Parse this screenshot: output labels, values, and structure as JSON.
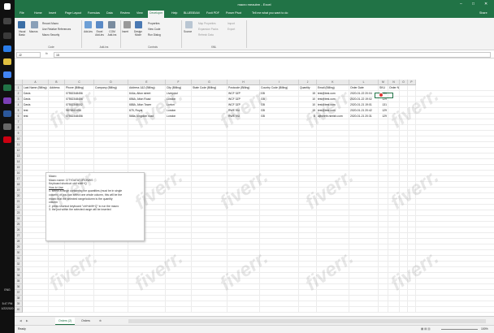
{
  "title": "macro meaubm - Excel",
  "window_controls": [
    "–",
    "□",
    "✕"
  ],
  "tabs": [
    "File",
    "Home",
    "Insert",
    "Page Layout",
    "Formulas",
    "Data",
    "Review",
    "View",
    "Developer",
    "Help",
    "BLUEBEAM",
    "Foxit PDF",
    "Power Pivot",
    "Tell me what you want to do",
    "Share"
  ],
  "active_tab": "Developer",
  "ribbon": {
    "code": {
      "visual_basic": "Visual Basic",
      "macros": "Macros",
      "record": "Record Macro",
      "relative": "Use Relative References",
      "security": "Macro Security",
      "group": "Code"
    },
    "addins": {
      "add_ins": "Add-ins",
      "excel_addins": "Excel Add-ins",
      "com_addins": "COM Add-ins",
      "group": "Add-ins"
    },
    "controls": {
      "insert": "Insert",
      "design": "Design Mode",
      "properties": "Properties",
      "view_code": "View Code",
      "run_dialog": "Run Dialog",
      "group": "Controls"
    },
    "xml": {
      "source": "Source",
      "map_props": "Map Properties",
      "expansion": "Expansion Packs",
      "refresh": "Refresh Data",
      "import": "Import",
      "export": "Export",
      "group": "XML"
    }
  },
  "name_box": "J2",
  "fx": "fx",
  "formula_value": "15",
  "columns": [
    "A",
    "B",
    "C",
    "D",
    "E",
    "F",
    "G",
    "H",
    "I",
    "J",
    "K",
    "L",
    "M",
    "N",
    "O",
    "P"
  ],
  "headers": [
    "Last Name (Billing)",
    "Address",
    "Phone (Billing)",
    "Company (Billing)",
    "Address 1&2 (Billing)",
    "City (Billing)",
    "State Code (Billing)",
    "Postcode (Billing)",
    "Country Code (Billing)",
    "Quantity",
    "Email (Billing)",
    "Order Date",
    "SKU",
    "Order Num"
  ],
  "rows": [
    [
      "Davis",
      "",
      "07552348456",
      "",
      "644a, Alton street",
      "Liverpool",
      "",
      "WCF 3ZP",
      "GB",
      "15",
      "test@test.com",
      "2020-01-22 20:04",
      "120",
      ""
    ],
    [
      "Davis",
      "",
      "07552348456",
      "",
      "656A, Alton Road",
      "London",
      "",
      "WCF 3ZP",
      "GB",
      "10",
      "test@test.com",
      "2020-01-22 19:02",
      "129",
      ""
    ],
    [
      "Davis",
      "",
      "07552348002",
      "",
      "688A, Alton Tower",
      "Lorton",
      "",
      "WCF 3ZP",
      "GB",
      "10",
      "test@test.com",
      "2020-01-21 19:01",
      "131",
      ""
    ],
    [
      "test",
      "",
      "9876543456",
      "",
      "675, Royal",
      "London",
      "",
      "RWE 9IU",
      "GB",
      "15",
      "test@test.com",
      "2020-01-21 20:42",
      "129",
      ""
    ],
    [
      "test",
      "",
      "07552348456",
      "",
      "568a, kingdom road",
      "London",
      "",
      "RWE 9IU",
      "GB",
      "8",
      "ajitsheth.nimish.com",
      "2020-01-21 20:31",
      "129",
      ""
    ]
  ],
  "row_numbers": [
    "1",
    "2",
    "3",
    "4",
    "5",
    "6",
    "7",
    "8",
    "9",
    "10",
    "11",
    "12",
    "13",
    "14",
    "15",
    "16",
    "17",
    "18",
    "19",
    "20",
    "21",
    "22",
    "23",
    "24",
    "25",
    "26",
    "27",
    "28",
    "29",
    "30",
    "31",
    "32",
    "33",
    "34",
    "35",
    "36",
    "37",
    "38",
    "39",
    "40"
  ],
  "note": {
    "title": "Macro",
    "lines": [
      "Macro name: CITYDATATORONWS",
      "Keyboard shortcut: ctrl+shift+Q",
      "",
      "How to Use:",
      "1. select a range containing the quantities (must be in single",
      "column) or you can select one whole column, this will be the",
      "macro that the selected range/column is the quantity",
      "column",
      "2. press shortcut keyboard \"ctrl+shift+Q\" to run the macro",
      "3. the just within the selected range will be inserted"
    ]
  },
  "sheet_tabs": [
    "Orders (2)",
    "Orders"
  ],
  "active_sheet": "Orders (2)",
  "status": "Ready",
  "zoom": "100%",
  "taskbar_clock": [
    "5:47 PM",
    "1/22/2020"
  ],
  "taskbar_lang": "ENG",
  "watermark": "fiverr."
}
